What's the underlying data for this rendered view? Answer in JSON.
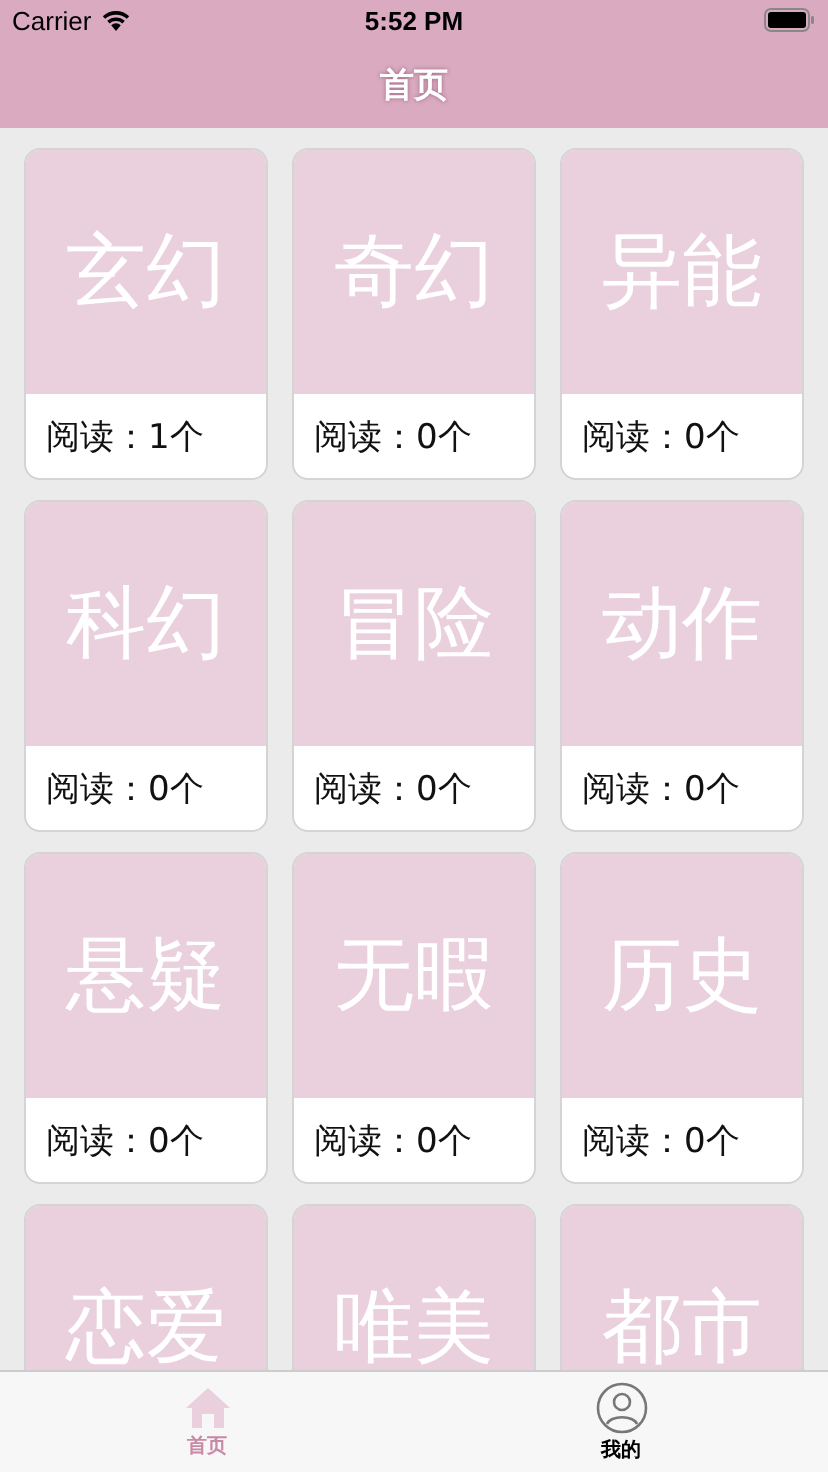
{
  "status_bar": {
    "carrier": "Carrier",
    "time": "5:52 PM"
  },
  "nav_bar": {
    "title": "首页"
  },
  "categories": [
    {
      "title": "玄幻",
      "reading": "阅读：1个"
    },
    {
      "title": "奇幻",
      "reading": "阅读：0个"
    },
    {
      "title": "异能",
      "reading": "阅读：0个"
    },
    {
      "title": "科幻",
      "reading": "阅读：0个"
    },
    {
      "title": "冒险",
      "reading": "阅读：0个"
    },
    {
      "title": "动作",
      "reading": "阅读：0个"
    },
    {
      "title": "悬疑",
      "reading": "阅读：0个"
    },
    {
      "title": "无暇",
      "reading": "阅读：0个"
    },
    {
      "title": "历史",
      "reading": "阅读：0个"
    },
    {
      "title": "恋爱"
    },
    {
      "title": "唯美"
    },
    {
      "title": "都市"
    }
  ],
  "tab_bar": [
    {
      "kind": "home",
      "label": "首页",
      "selected": true
    },
    {
      "kind": "profile",
      "label": "我的",
      "selected": false
    }
  ]
}
